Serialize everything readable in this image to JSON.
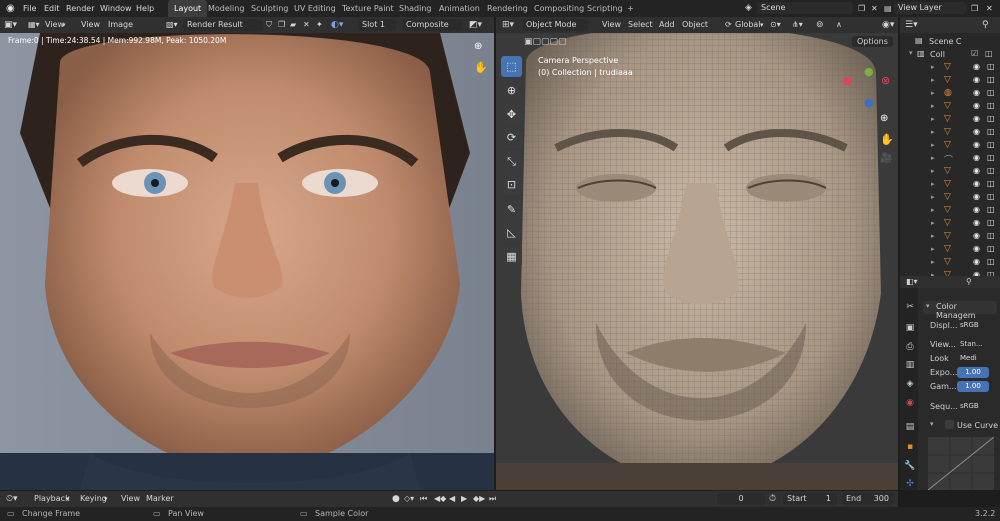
{
  "top_menu": {
    "logo": "blender-logo",
    "items": [
      "File",
      "Edit",
      "Render",
      "Window",
      "Help"
    ]
  },
  "workspaces": [
    "Layout",
    "Modeling",
    "Sculpting",
    "UV Editing",
    "Texture Paint",
    "Shading",
    "Animation",
    "Rendering",
    "Compositing",
    "Scripting",
    "+"
  ],
  "scene": {
    "name": "Scene",
    "view_layer": "View Layer"
  },
  "image_editor": {
    "view": "View",
    "view2": "View",
    "image": "Image",
    "image_name": "Render Result",
    "slot": "Slot 1",
    "pass": "Composite",
    "stats": "Frame:0 | Time:24:38.54 | Mem:992.98M, Peak: 1050.20M"
  },
  "viewport": {
    "mode": "Object Mode",
    "menus": [
      "View",
      "Select",
      "Add",
      "Object"
    ],
    "transform": "Global",
    "options": "Options",
    "overlay_title": "Camera Perspective",
    "overlay_sub": "(0) Collection | trudiaaa"
  },
  "outliner": {
    "scene_collection": "Scene C",
    "collection": "Coll",
    "row_count": 17
  },
  "properties": {
    "section": "Color Managem",
    "rows": [
      {
        "label": "Displ...",
        "value": "sRGB"
      },
      {
        "label": "View...",
        "value": "Stan..."
      },
      {
        "label": "Look",
        "value": "Medi"
      },
      {
        "label": "Expo...",
        "value": "1.00"
      },
      {
        "label": "Gam...",
        "value": "1.00"
      },
      {
        "label": "Sequ...",
        "value": "sRGB"
      }
    ],
    "use_curves": "Use Curve"
  },
  "timeline": {
    "playback": "Playback",
    "keying": "Keying",
    "view": "View",
    "marker": "Marker",
    "current_frame": "0",
    "start_label": "Start",
    "start": "1",
    "end_label": "End",
    "end": "300"
  },
  "statusbar": {
    "items": [
      "Change Frame",
      "Pan View",
      "Sample Color"
    ],
    "version": "3.2.2"
  },
  "colors": {
    "accent": "#4772b3",
    "header": "#303030",
    "panel": "#1d1d1d"
  }
}
